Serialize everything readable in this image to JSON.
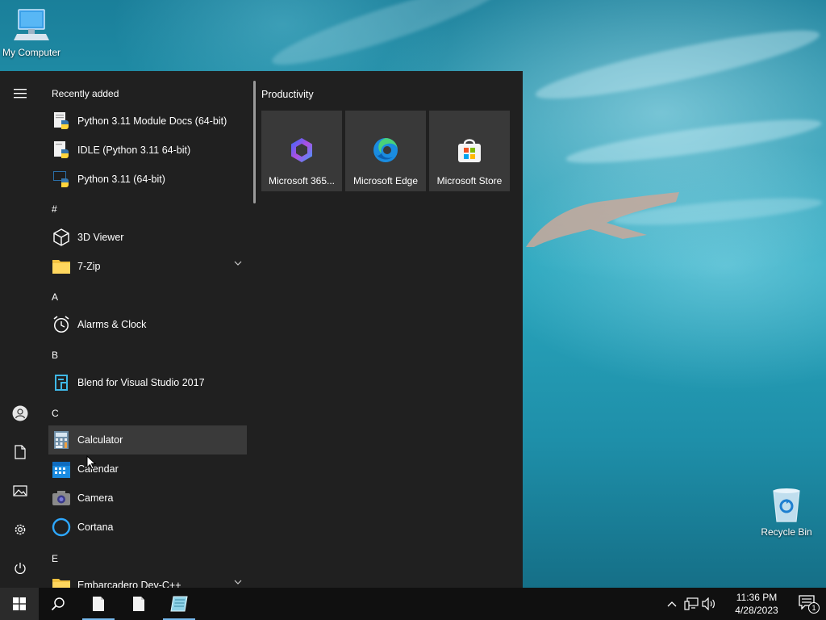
{
  "desktop": {
    "icons": [
      {
        "label": "My Computer",
        "icon": "computer-icon"
      },
      {
        "label": "Recycle Bin",
        "icon": "recycle-bin-icon"
      }
    ]
  },
  "start_menu": {
    "rail": {
      "items": [
        {
          "icon": "hamburger-menu-icon"
        },
        {
          "icon": "user-icon"
        },
        {
          "icon": "document-icon"
        },
        {
          "icon": "pictures-icon"
        },
        {
          "icon": "settings-gear-icon"
        },
        {
          "icon": "power-icon"
        }
      ]
    },
    "recently_added_label": "Recently added",
    "recent": [
      {
        "label": "Python 3.11 Module Docs (64-bit)",
        "icon": "python-docs-icon"
      },
      {
        "label": "IDLE (Python 3.11 64-bit)",
        "icon": "python-idle-icon"
      },
      {
        "label": "Python 3.11 (64-bit)",
        "icon": "python-icon"
      }
    ],
    "groups": [
      {
        "letter": "#",
        "apps": [
          {
            "label": "3D Viewer",
            "icon": "cube-icon"
          },
          {
            "label": "7-Zip",
            "icon": "folder-icon",
            "expandable": true
          }
        ]
      },
      {
        "letter": "A",
        "apps": [
          {
            "label": "Alarms & Clock",
            "icon": "alarm-clock-icon"
          }
        ]
      },
      {
        "letter": "B",
        "apps": [
          {
            "label": "Blend for Visual Studio 2017",
            "icon": "blend-icon"
          }
        ]
      },
      {
        "letter": "C",
        "apps": [
          {
            "label": "Calculator",
            "icon": "calculator-icon",
            "hovered": true
          },
          {
            "label": "Calendar",
            "icon": "calendar-icon"
          },
          {
            "label": "Camera",
            "icon": "camera-icon"
          },
          {
            "label": "Cortana",
            "icon": "cortana-icon"
          }
        ]
      },
      {
        "letter": "E",
        "apps": [
          {
            "label": "Embarcadero Dev-C++",
            "icon": "folder-icon",
            "expandable": true
          }
        ]
      }
    ],
    "tiles_group_title": "Productivity",
    "tiles": [
      {
        "label": "Microsoft 365...",
        "icon": "microsoft-365-icon"
      },
      {
        "label": "Microsoft Edge",
        "icon": "edge-icon"
      },
      {
        "label": "Microsoft Store",
        "icon": "store-icon"
      }
    ]
  },
  "taskbar": {
    "buttons": [
      {
        "icon": "windows-start-icon"
      },
      {
        "icon": "search-icon"
      },
      {
        "icon": "file-icon"
      },
      {
        "icon": "file-icon"
      },
      {
        "icon": "notepad-icon"
      }
    ],
    "clock": {
      "time": "11:36 PM",
      "date": "4/28/2023"
    },
    "notification_count": "1"
  },
  "colors": {
    "menu_bg": "#202020",
    "tile_bg": "#393939",
    "taskbar_bg": "#101010",
    "hover_bg": "#3a3a3a",
    "accent": "#76b9ed"
  }
}
